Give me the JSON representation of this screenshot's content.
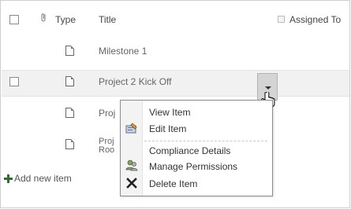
{
  "header": {
    "type_label": "Type",
    "title_label": "Title",
    "assigned_label": "Assigned To"
  },
  "rows": [
    {
      "title": "Milestone 1"
    },
    {
      "title": "Project 2 Kick Off"
    },
    {
      "title": "Proj"
    },
    {
      "title_line1": "Proj",
      "title_line2": "Roo"
    }
  ],
  "add_new_item": "Add new item",
  "context_menu": {
    "items": [
      {
        "label": "View Item",
        "icon": "none"
      },
      {
        "label": "Edit Item",
        "icon": "edit-icon"
      },
      {
        "label": "Compliance Details",
        "icon": "none"
      },
      {
        "label": "Manage Permissions",
        "icon": "permissions-icon"
      },
      {
        "label": "Delete Item",
        "icon": "delete-x-icon"
      }
    ]
  }
}
